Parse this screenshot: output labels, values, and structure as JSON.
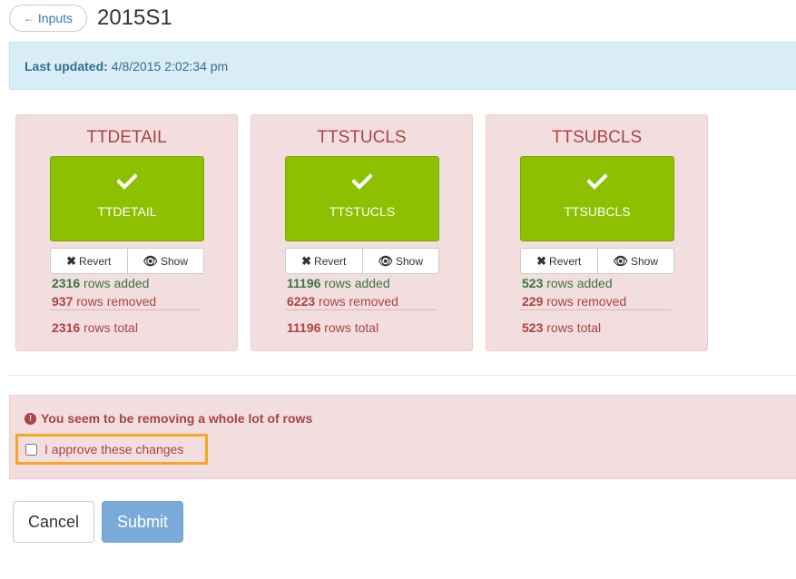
{
  "header": {
    "back_label": "Inputs",
    "back_arrow": "←",
    "title": "2015S1"
  },
  "info": {
    "label": "Last updated:",
    "value": "4/8/2015 2:02:34 pm"
  },
  "cards": [
    {
      "title": "TTDETAIL",
      "tile_label": "TTDETAIL",
      "revert_label": "Revert",
      "show_label": "Show",
      "added_num": "2316",
      "added_text": "rows added",
      "removed_num": "937",
      "removed_text": "rows removed",
      "total_num": "2316",
      "total_text": "rows total"
    },
    {
      "title": "TTSTUCLS",
      "tile_label": "TTSTUCLS",
      "revert_label": "Revert",
      "show_label": "Show",
      "added_num": "11196",
      "added_text": "rows added",
      "removed_num": "6223",
      "removed_text": "rows removed",
      "total_num": "11196",
      "total_text": "rows total"
    },
    {
      "title": "TTSUBCLS",
      "tile_label": "TTSUBCLS",
      "revert_label": "Revert",
      "show_label": "Show",
      "added_num": "523",
      "added_text": "rows added",
      "removed_num": "229",
      "removed_text": "rows removed",
      "total_num": "523",
      "total_text": "rows total"
    }
  ],
  "warning": {
    "icon": "exclamation-circle-icon",
    "message": "You seem to be removing a whole lot of rows",
    "approve_label": "I approve these changes",
    "approve_checked": false
  },
  "actions": {
    "cancel_label": "Cancel",
    "submit_label": "Submit"
  },
  "colors": {
    "success_tile": "#8cc000",
    "danger_bg": "#f2dede",
    "danger_text": "#a94442",
    "success_text": "#3c763d",
    "info_bg": "#d9edf7",
    "primary_disabled": "#7aaad7",
    "highlight": "#f5a623"
  }
}
